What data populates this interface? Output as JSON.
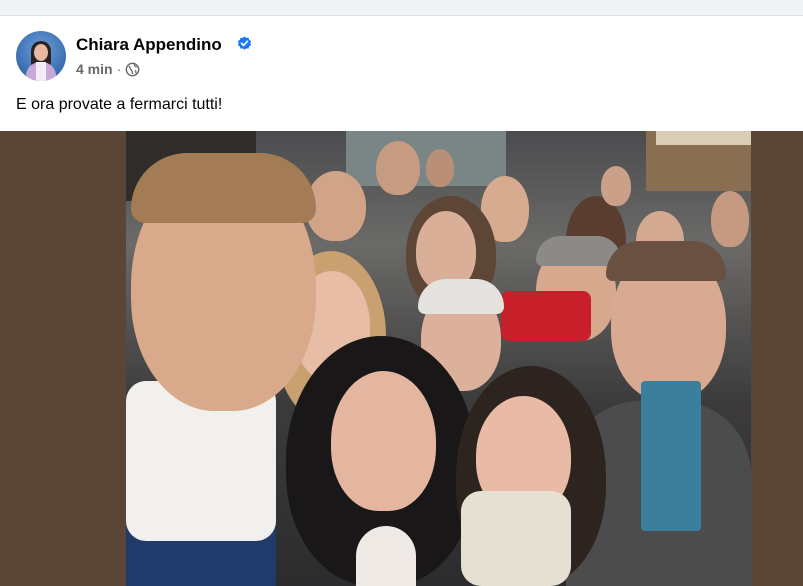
{
  "post": {
    "author": "Chiara Appendino",
    "time": "4 min",
    "separator": "·",
    "text": "E ora provate a fermarci tutti!"
  },
  "icons": {
    "verified": "verified-badge-icon",
    "audience": "globe-icon"
  },
  "colors": {
    "verified_blue": "#1877f2",
    "media_background": "#5a4536",
    "meta_gray": "#65676b"
  }
}
